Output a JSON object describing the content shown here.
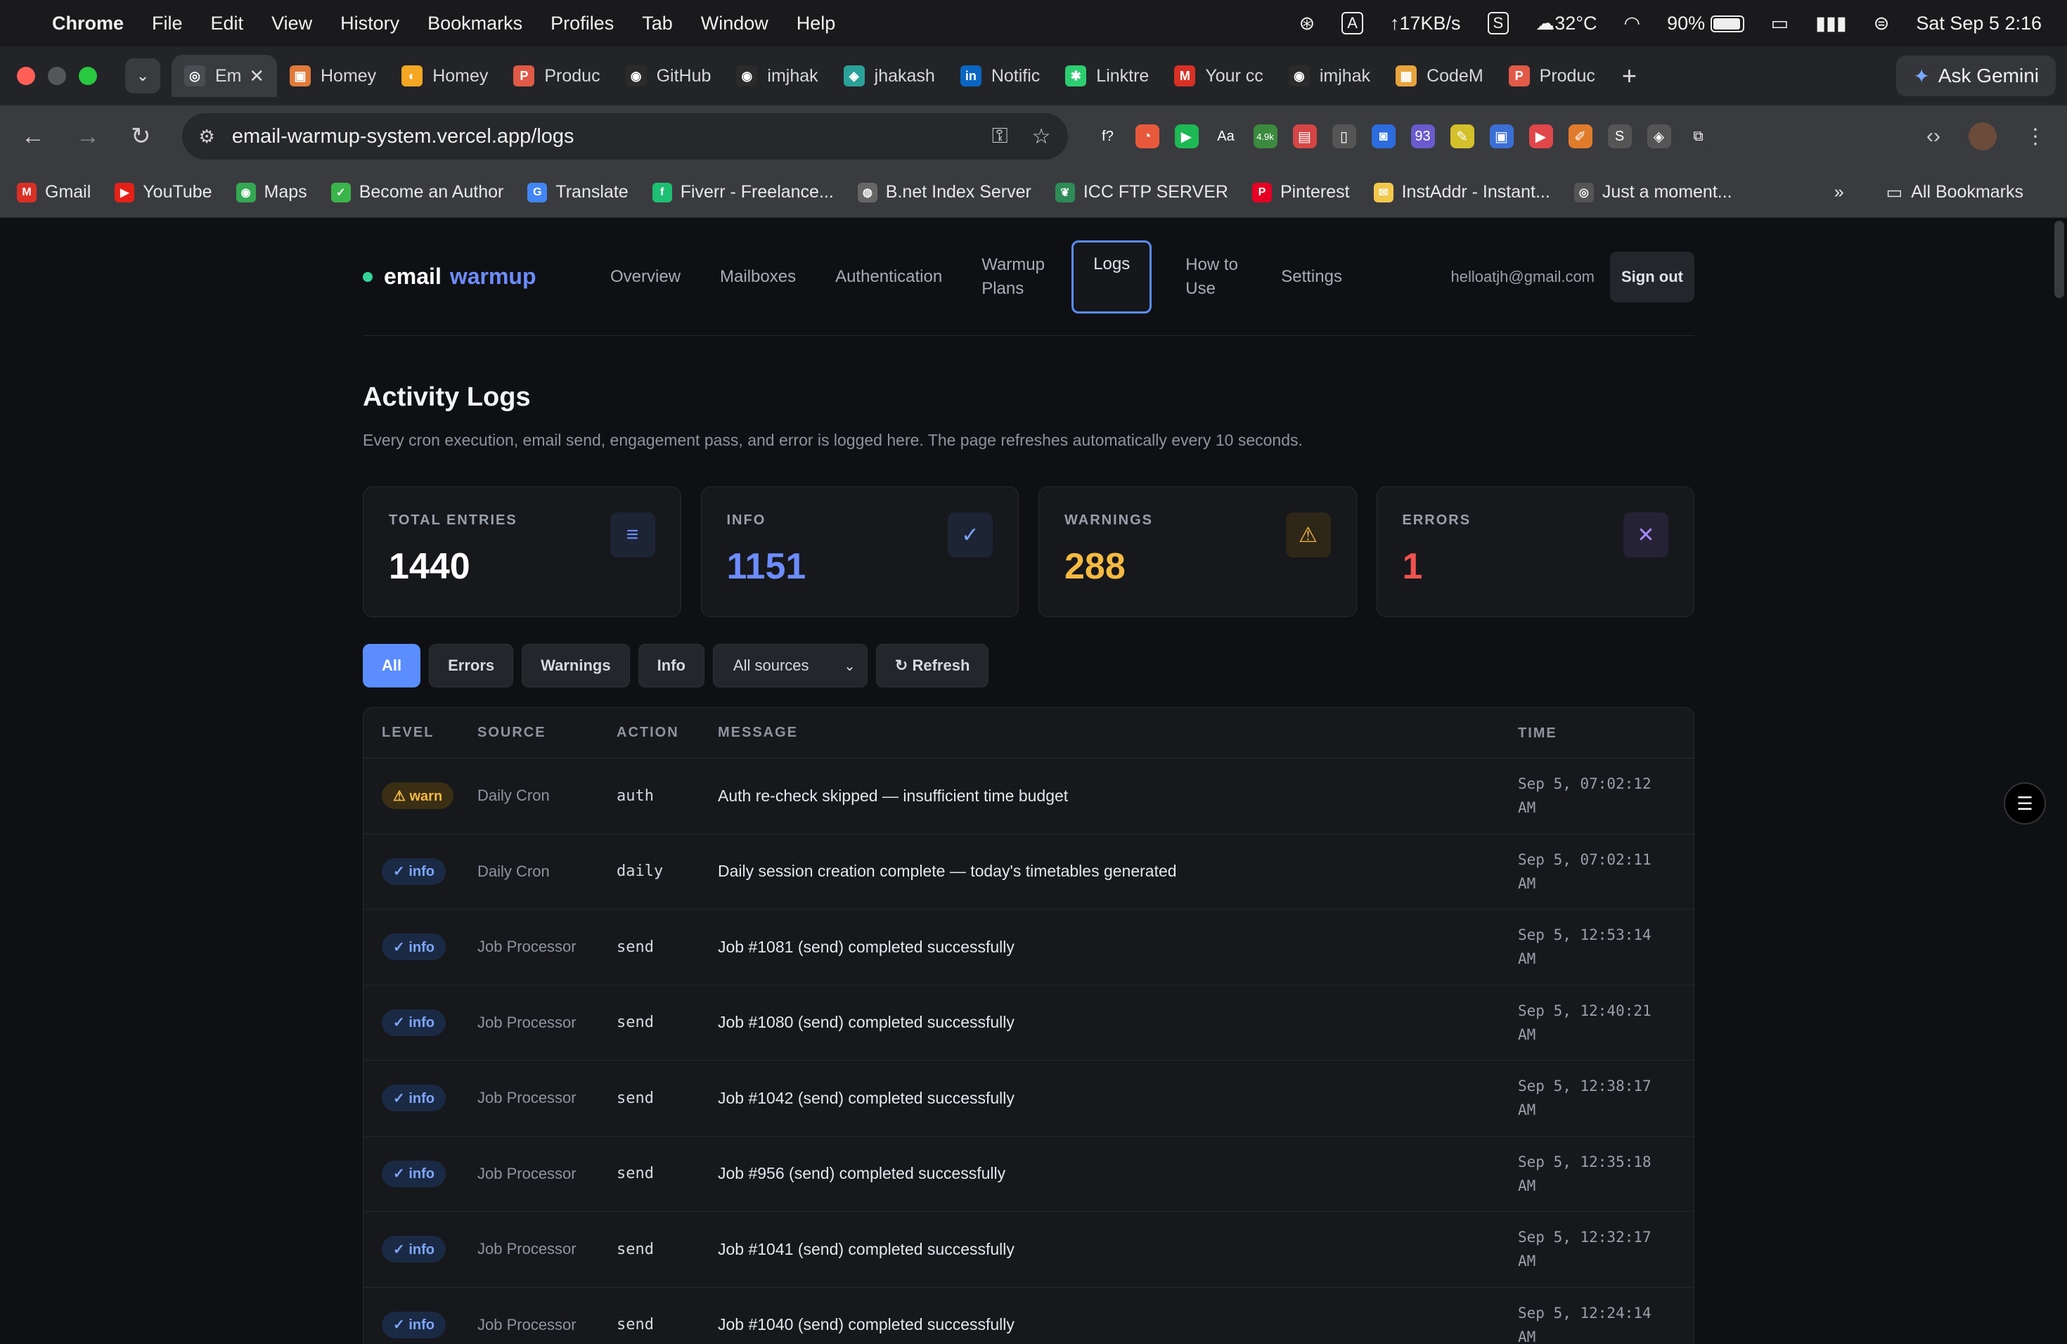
{
  "menubar": {
    "app": "Chrome",
    "items": [
      "File",
      "Edit",
      "View",
      "History",
      "Bookmarks",
      "Profiles",
      "Tab",
      "Window",
      "Help"
    ],
    "status": {
      "ime": "A",
      "network": "↑17KB/s",
      "s_badge": "S",
      "weather": "32°C",
      "battery": "90%",
      "datetime": "Sat Sep 5  2:16"
    }
  },
  "tabs": [
    {
      "label": "Em",
      "color": "#4b4d52",
      "glyph": "◎"
    },
    {
      "label": "Homey",
      "color": "#e07a3a",
      "glyph": "▣"
    },
    {
      "label": "Homey",
      "color": "#f5a623",
      "glyph": "◐"
    },
    {
      "label": "Produc",
      "color": "#e05a47",
      "glyph": "P"
    },
    {
      "label": "GitHub",
      "color": "#2b2b2b",
      "glyph": "◉"
    },
    {
      "label": "imjhak",
      "color": "#2b2b2b",
      "glyph": "◉"
    },
    {
      "label": "jhakash",
      "color": "#2aa198",
      "glyph": "◈"
    },
    {
      "label": "Notific",
      "color": "#0a66c2",
      "glyph": "in"
    },
    {
      "label": "Linktre",
      "color": "#2ecc71",
      "glyph": "✱"
    },
    {
      "label": "Your cc",
      "color": "#d93025",
      "glyph": "M"
    },
    {
      "label": "imjhak",
      "color": "#2b2b2b",
      "glyph": "◉"
    },
    {
      "label": "CodeM",
      "color": "#e8a33c",
      "glyph": "▦"
    },
    {
      "label": "Produc",
      "color": "#e05a47",
      "glyph": "P"
    }
  ],
  "tab_close": "✕",
  "new_tab": "+",
  "gemini_label": "Ask Gemini",
  "omnibox": {
    "url": "email-warmup-system.vercel.app/logs"
  },
  "extensions": [
    {
      "glyph": "f?",
      "color": "#3a3b3f"
    },
    {
      "glyph": "◔",
      "color": "#e8593c"
    },
    {
      "glyph": "▶",
      "color": "#1db954"
    },
    {
      "glyph": "Aa",
      "color": "#3a3b3f"
    },
    {
      "glyph": "4.9k",
      "color": "#3b8a3e"
    },
    {
      "glyph": "▤",
      "color": "#d64545"
    },
    {
      "glyph": "▯",
      "color": "#555"
    },
    {
      "glyph": "◙",
      "color": "#2d6cdf"
    },
    {
      "glyph": "93",
      "color": "#6a5acd"
    },
    {
      "glyph": "✎",
      "color": "#d4c02a"
    },
    {
      "glyph": "▣",
      "color": "#3b6fd6"
    },
    {
      "glyph": "▶",
      "color": "#e0464a"
    },
    {
      "glyph": "✐",
      "color": "#e07b2c"
    },
    {
      "glyph": "S",
      "color": "#555"
    },
    {
      "glyph": "◈",
      "color": "#555"
    },
    {
      "glyph": "⧉",
      "color": "#3a3b3f"
    }
  ],
  "bookmarks": [
    {
      "label": "Gmail",
      "color": "#d93025",
      "glyph": "M"
    },
    {
      "label": "YouTube",
      "color": "#e62117",
      "glyph": "▶"
    },
    {
      "label": "Maps",
      "color": "#34a853",
      "glyph": "◉"
    },
    {
      "label": "Become an Author",
      "color": "#3bb54a",
      "glyph": "✓"
    },
    {
      "label": "Translate",
      "color": "#4285f4",
      "glyph": "G"
    },
    {
      "label": "Fiverr - Freelance...",
      "color": "#1dbf73",
      "glyph": "f"
    },
    {
      "label": "B.net Index Server",
      "color": "#666",
      "glyph": "◍"
    },
    {
      "label": "ICC FTP SERVER",
      "color": "#2e8b57",
      "glyph": "❦"
    },
    {
      "label": "Pinterest",
      "color": "#e60023",
      "glyph": "P"
    },
    {
      "label": "InstAddr - Instant...",
      "color": "#f2c94c",
      "glyph": "✉"
    },
    {
      "label": "Just a moment...",
      "color": "#555",
      "glyph": "◎"
    }
  ],
  "bookmarks_more": "»",
  "all_bookmarks": "All Bookmarks",
  "app": {
    "brand_left": "email",
    "brand_right": "warmup",
    "nav": [
      "Overview",
      "Mailboxes",
      "Authentication",
      "Warmup Plans",
      "Logs",
      "How to Use",
      "Settings"
    ],
    "active_nav": "Logs",
    "user_email": "helloatjh@gmail.com",
    "sign_out": "Sign out"
  },
  "page": {
    "title": "Activity Logs",
    "description": "Every cron execution, email send, engagement pass, and error is logged here. The page refreshes automatically every 10 seconds."
  },
  "stats": [
    {
      "label": "TOTAL ENTRIES",
      "value": "1440",
      "icon": "≡",
      "color": "#ffffff",
      "icon_color": "#6d8cff",
      "icon_bg": "#1d2434"
    },
    {
      "label": "INFO",
      "value": "1151",
      "icon": "✓",
      "color": "#6d8cff",
      "icon_color": "#7ea6ff",
      "icon_bg": "#1d2434"
    },
    {
      "label": "WARNINGS",
      "value": "288",
      "icon": "⚠",
      "color": "#f5b942",
      "icon_color": "#f5b942",
      "icon_bg": "#2e2718"
    },
    {
      "label": "ERRORS",
      "value": "1",
      "icon": "✕",
      "color": "#f0524f",
      "icon_color": "#a78bfa",
      "icon_bg": "#262236"
    }
  ],
  "filters": {
    "buttons": [
      "All",
      "Errors",
      "Warnings",
      "Info"
    ],
    "active": "All",
    "source_select": "All sources",
    "refresh": "↻ Refresh"
  },
  "table": {
    "headers": [
      "LEVEL",
      "SOURCE",
      "ACTION",
      "MESSAGE",
      "TIME"
    ],
    "rows": [
      {
        "level": "warn",
        "badge": "⚠ warn",
        "source": "Daily Cron",
        "action": "auth",
        "message": "Auth re-check skipped — insufficient time budget",
        "time1": "Sep 5, 07:02:12",
        "time2": "AM"
      },
      {
        "level": "info",
        "badge": "✓ info",
        "source": "Daily Cron",
        "action": "daily",
        "message": "Daily session creation complete — today's timetables generated",
        "time1": "Sep 5, 07:02:11",
        "time2": "AM"
      },
      {
        "level": "info",
        "badge": "✓ info",
        "source": "Job Processor",
        "action": "send",
        "message": "Job #1081 (send) completed successfully",
        "time1": "Sep 5, 12:53:14",
        "time2": "AM"
      },
      {
        "level": "info",
        "badge": "✓ info",
        "source": "Job Processor",
        "action": "send",
        "message": "Job #1080 (send) completed successfully",
        "time1": "Sep 5, 12:40:21",
        "time2": "AM"
      },
      {
        "level": "info",
        "badge": "✓ info",
        "source": "Job Processor",
        "action": "send",
        "message": "Job #1042 (send) completed successfully",
        "time1": "Sep 5, 12:38:17",
        "time2": "AM"
      },
      {
        "level": "info",
        "badge": "✓ info",
        "source": "Job Processor",
        "action": "send",
        "message": "Job #956 (send) completed successfully",
        "time1": "Sep 5, 12:35:18",
        "time2": "AM"
      },
      {
        "level": "info",
        "badge": "✓ info",
        "source": "Job Processor",
        "action": "send",
        "message": "Job #1041 (send) completed successfully",
        "time1": "Sep 5, 12:32:17",
        "time2": "AM"
      },
      {
        "level": "info",
        "badge": "✓ info",
        "source": "Job Processor",
        "action": "send",
        "message": "Job #1040 (send) completed successfully",
        "time1": "Sep 5, 12:24:14",
        "time2": "AM"
      }
    ]
  }
}
